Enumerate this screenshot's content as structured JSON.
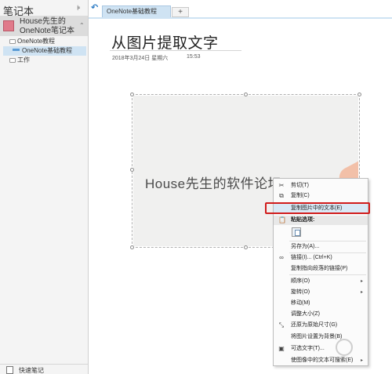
{
  "nav": {
    "title": "笔记本",
    "pin": "⊧",
    "notebook": {
      "name": "House先生的OneNote笔记本",
      "color": "#e07a8a"
    },
    "sections": [
      {
        "label": "OneNote教程"
      },
      {
        "label": "OneNote基础教程"
      },
      {
        "label": "工作"
      }
    ],
    "quick_notes": "快速笔记"
  },
  "tabs": {
    "back": "↶",
    "active": "OneNote基础教程",
    "add": "+"
  },
  "page": {
    "title": "从图片提取文字",
    "date": "2018年3月24日 星期六",
    "time": "15:53"
  },
  "image": {
    "text": "House先生的软件论坛"
  },
  "menu": {
    "items": [
      {
        "label": "剪切(T)",
        "icon": "cut-icon",
        "glyph": "✂"
      },
      {
        "label": "复制(C)",
        "icon": "copy-icon",
        "glyph": "⧉"
      },
      {
        "label": "复制图片中的文本(E)",
        "icon": "",
        "glyph": ""
      },
      {
        "label": "粘贴选项:",
        "icon": "paste-icon",
        "glyph": "📋"
      },
      {
        "label": "另存为(A)...",
        "icon": "",
        "glyph": ""
      },
      {
        "label": "链接(I)...  (Ctrl+K)",
        "icon": "link-icon",
        "glyph": "🔗"
      },
      {
        "label": "复制指向段落的链接(P)",
        "icon": "",
        "glyph": ""
      },
      {
        "label": "顺序(O)",
        "icon": "",
        "glyph": "",
        "submenu": "▸"
      },
      {
        "label": "旋转(O)",
        "icon": "",
        "glyph": "",
        "submenu": "▸"
      },
      {
        "label": "移动(M)",
        "icon": "",
        "glyph": ""
      },
      {
        "label": "调整大小(Z)",
        "icon": "",
        "glyph": ""
      },
      {
        "label": "还原为原始尺寸(G)",
        "icon": "restore-size-icon",
        "glyph": "⤡"
      },
      {
        "label": "将图片设置为背景(B)",
        "icon": "",
        "glyph": ""
      },
      {
        "label": "可选文字(T)...",
        "icon": "alt-text-icon",
        "glyph": "▣"
      },
      {
        "label": "使图像中的文本可搜索(E)",
        "icon": "",
        "glyph": "",
        "submenu": "▸"
      }
    ],
    "highlight_color": "#d11c1c"
  }
}
